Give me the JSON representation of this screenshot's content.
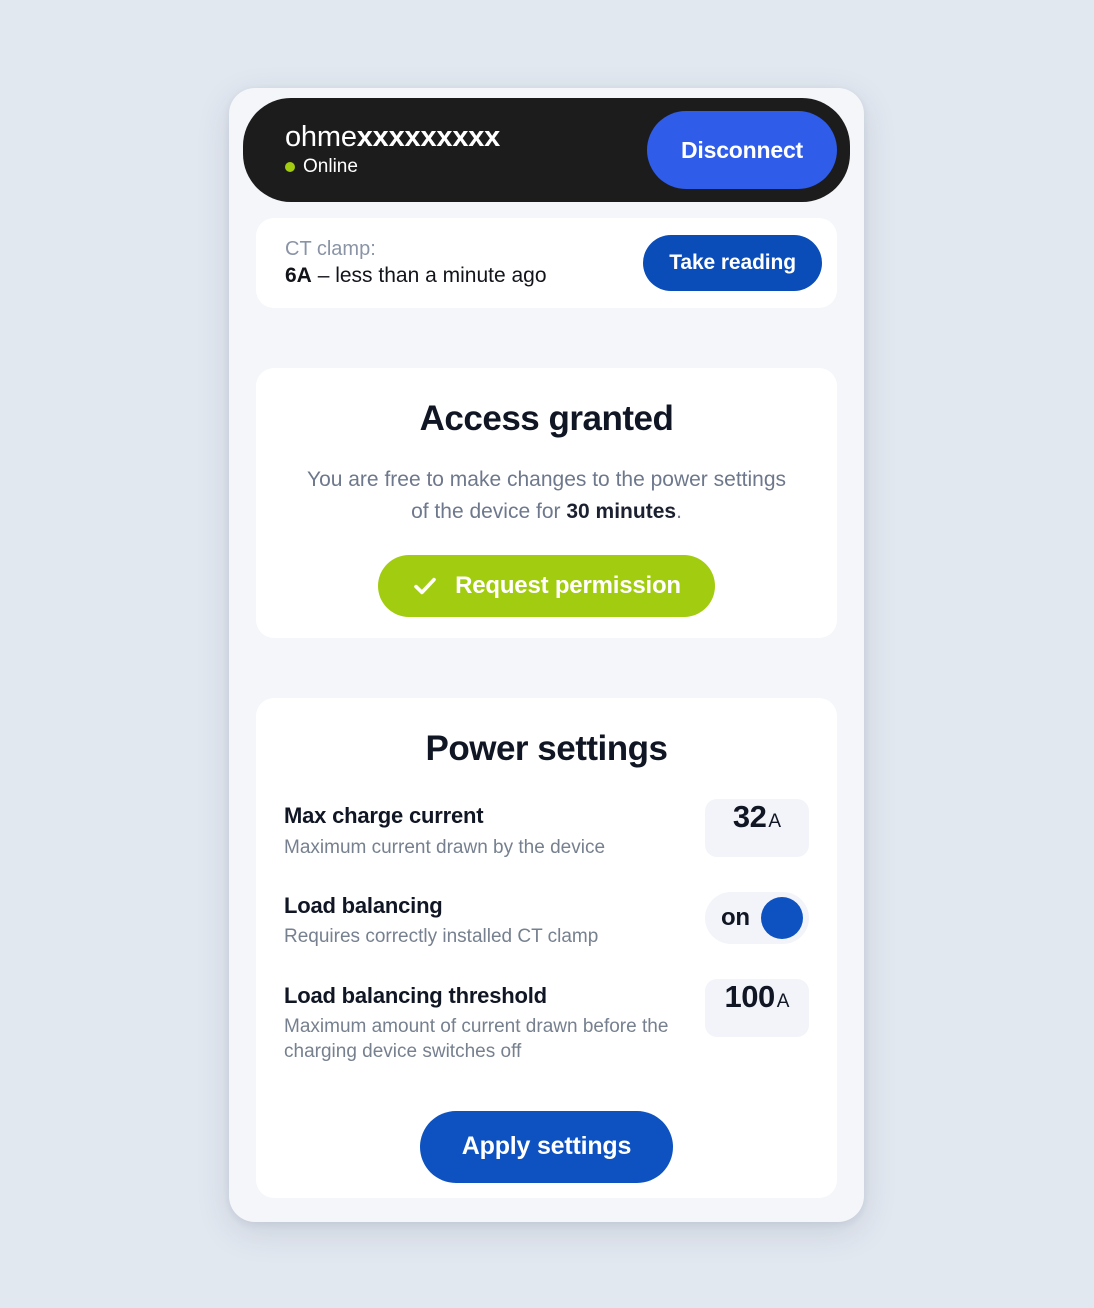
{
  "device": {
    "id_prefix": "ohme",
    "id_suffix": "xxxxxxxxx",
    "status_label": "Online",
    "status_dot_icon": "status-dot-online",
    "status_color": "#a2cc10",
    "disconnect_label": "Disconnect",
    "disconnect_color": "#2f5ce8"
  },
  "ct_clamp": {
    "label": "CT clamp:",
    "value": "6A",
    "value_suffix": " – less than a minute ago",
    "button_label": "Take reading",
    "button_color": "#0a4cb8"
  },
  "access": {
    "title": "Access granted",
    "description_prefix": "You are free to make changes to the power settings of the device for ",
    "duration": "30 minutes",
    "description_suffix": ".",
    "button_label": "Request permission",
    "button_icon": "check-icon",
    "button_color": "#a2cc10"
  },
  "power_settings": {
    "title": "Power settings",
    "rows": [
      {
        "name": "Max charge current",
        "description": "Maximum current drawn by the device",
        "control": "value",
        "value": "32",
        "unit": "A"
      },
      {
        "name": "Load balancing",
        "description": "Requires correctly installed CT clamp",
        "control": "toggle",
        "value": "on",
        "knob_color": "#0d52c0"
      },
      {
        "name": "Load balancing threshold",
        "description": "Maximum amount of current drawn before the charging device switches off",
        "control": "value",
        "value": "100",
        "unit": "A"
      }
    ],
    "apply_label": "Apply settings",
    "apply_color": "#0d52c0"
  }
}
